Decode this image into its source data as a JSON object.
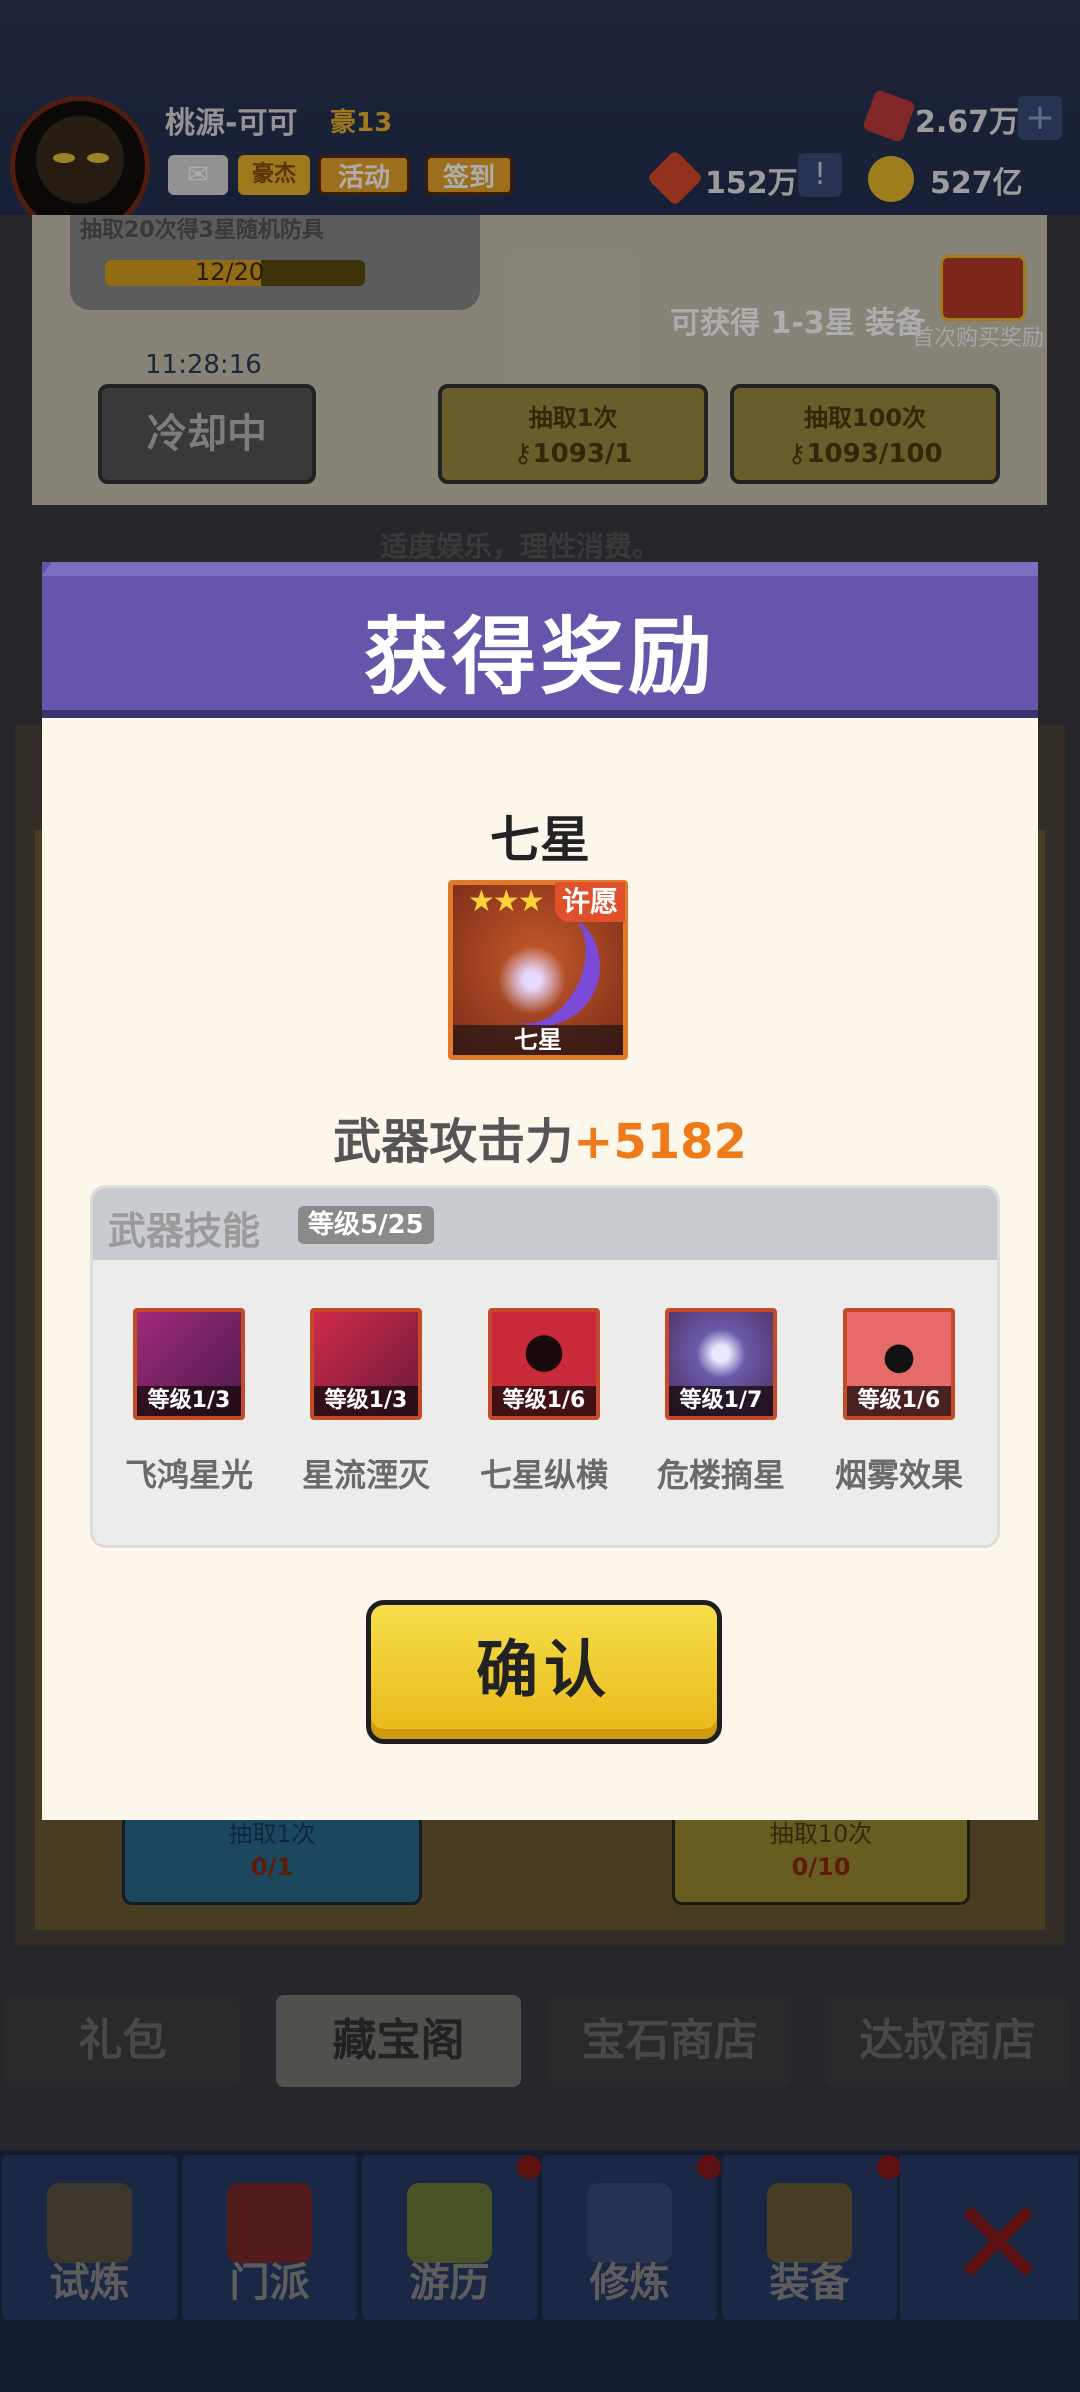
{
  "header": {
    "player_name": "桃源-可可",
    "rank_badge": "豪13",
    "mail_label": "",
    "rank_label": "豪杰",
    "activity_label": "活动",
    "checkin_label": "签到",
    "gems": "2.67万",
    "gem_add": "+",
    "tokens": "152万",
    "token_add": "!",
    "coins": "527亿"
  },
  "shop_top": {
    "progress_text": "抽取20次得3星随机防具",
    "progress_value": "12/20",
    "progress_fraction": 0.6,
    "get_text": "可获得 1-3星 装备",
    "first_buy": "首次购买奖励",
    "timer": "11:28:16",
    "cooldown_label": "冷却中",
    "draw1_label": "抽取1次",
    "draw1_cost": "1093/1",
    "draw100_label": "抽取100次",
    "draw100_cost": "1093/100",
    "notice": "适度娱乐，理性消费。"
  },
  "shop_lower": {
    "draw1_label": "抽取1次",
    "draw1_cost": "0/1",
    "draw10_label": "抽取10次",
    "draw10_cost": "0/10"
  },
  "shop_tabs": [
    "礼包",
    "藏宝阁",
    "宝石商店",
    "达叔商店"
  ],
  "bottom_nav": [
    "试炼",
    "门派",
    "游历",
    "修炼",
    "装备"
  ],
  "modal": {
    "title": "获得奖励",
    "item_name": "七星",
    "item_card_label": "七星",
    "item_stars": "★★★",
    "wish_badge": "许愿",
    "attack_label": "武器攻击力",
    "attack_value": "+5182",
    "skill_title": "武器技能",
    "skill_level": "等级5/25",
    "skills": [
      {
        "name": "飞鸿星光",
        "level": "等级1/3"
      },
      {
        "name": "星流湮灭",
        "level": "等级1/3"
      },
      {
        "name": "七星纵横",
        "level": "等级1/6"
      },
      {
        "name": "危楼摘星",
        "level": "等级1/7"
      },
      {
        "name": "烟雾效果",
        "level": "等级1/6"
      }
    ],
    "confirm_label": "确认"
  },
  "colors": {
    "modal_header": "#6655aa",
    "modal_body": "#fcf7ea",
    "attack_value": "#ef7a1a",
    "confirm_button": "#f2cf30"
  }
}
